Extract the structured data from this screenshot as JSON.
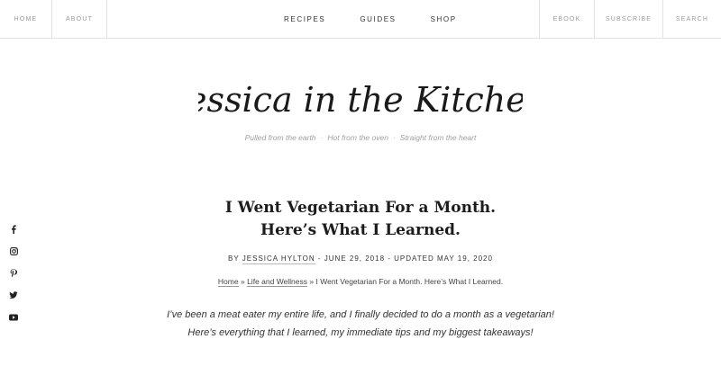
{
  "nav": {
    "left": [
      "Home",
      "About"
    ],
    "center": [
      "Recipes",
      "Guides",
      "Shop"
    ],
    "right": [
      "eBook",
      "Subscribe",
      "Search"
    ]
  },
  "site": {
    "logo_text": "Jessica in the Kitchen",
    "tagline": [
      "Pulled from the earth",
      "Hot from the oven",
      "Straight from the heart"
    ],
    "tagline_separator": "·"
  },
  "post": {
    "title_line1": "I Went Vegetarian For a Month.",
    "title_line2": "Here’s What I Learned.",
    "by_prefix": "By",
    "author": "Jessica Hylton",
    "date_text": "- June 29, 2018 - Updated May 19, 2020",
    "breadcrumb": {
      "home": "Home",
      "sep": "»",
      "category": "Life and Wellness",
      "current": "I Went Vegetarian For a Month. Here’s What I Learned."
    },
    "intro_line1": "I’ve been a meat eater my entire life, and I finally decided to do a month as a vegetarian!",
    "intro_line2": "Here’s everything that I learned, my immediate tips and my biggest takeaways!"
  },
  "social": [
    "facebook-icon",
    "instagram-icon",
    "pinterest-icon",
    "twitter-icon",
    "youtube-icon"
  ],
  "colors": {
    "text": "#1d1d1d",
    "muted": "#9a9a9a",
    "border": "#e2e2e2"
  }
}
